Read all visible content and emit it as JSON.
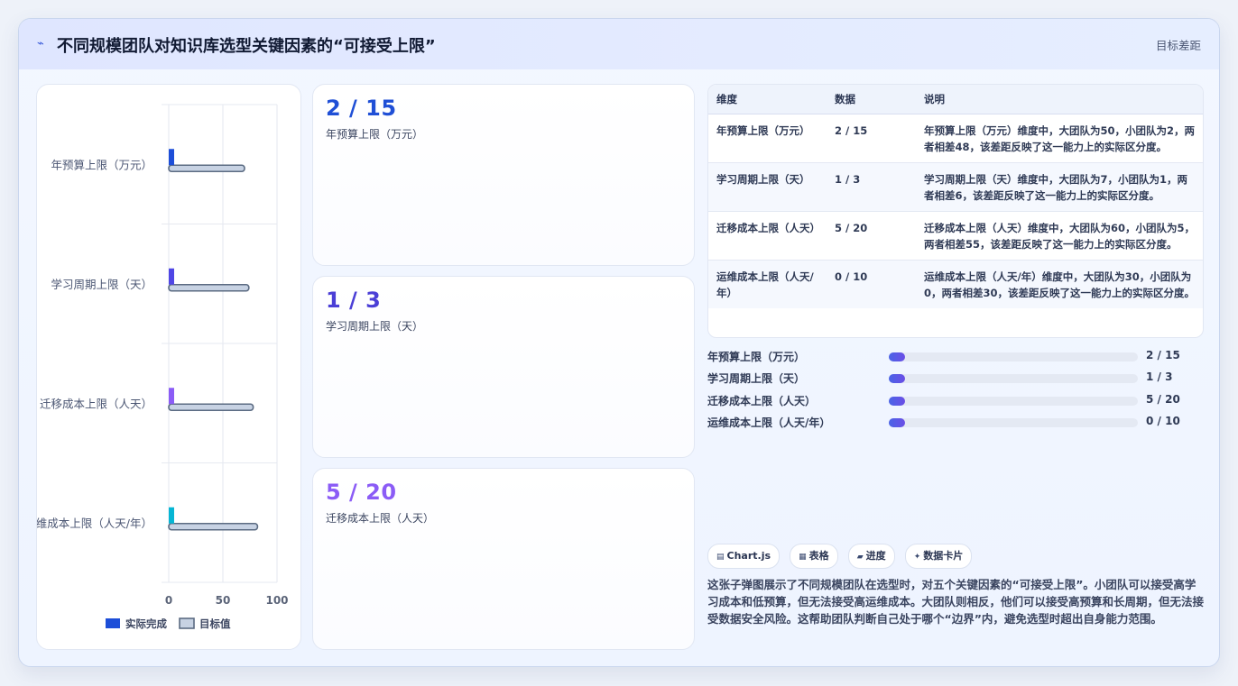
{
  "header": {
    "icon": "chart-pulse-icon",
    "title": "不同规模团队对知识库选型关键因素的“可接受上限”",
    "right_label": "目标差距"
  },
  "stats": [
    {
      "value": "2 / 15",
      "label": "年预算上限（万元）",
      "color": "#1f4fd6"
    },
    {
      "value": "1 / 3",
      "label": "学习周期上限（天）",
      "color": "#4b3fd6"
    },
    {
      "value": "5 / 20",
      "label": "迁移成本上限（人天）",
      "color": "#8b5cf6"
    }
  ],
  "table": {
    "headers": [
      "维度",
      "数据",
      "说明"
    ],
    "rows": [
      {
        "dim": "年预算上限（万元）",
        "data": "2 / 15",
        "desc": "年预算上限（万元）维度中，大团队为50，小团队为2，两者相差48，该差距反映了这一能力上的实际区分度。"
      },
      {
        "dim": "学习周期上限（天）",
        "data": "1 / 3",
        "desc": "学习周期上限（天）维度中，大团队为7，小团队为1，两者相差6，该差距反映了这一能力上的实际区分度。"
      },
      {
        "dim": "迁移成本上限（人天）",
        "data": "5 / 20",
        "desc": "迁移成本上限（人天）维度中，大团队为60，小团队为5，两者相差55，该差距反映了这一能力上的实际区分度。"
      },
      {
        "dim": "运维成本上限（人天/年）",
        "data": "0 / 10",
        "desc": "运维成本上限（人天/年）维度中，大团队为30，小团队为0，两者相差30，该差距反映了这一能力上的实际区分度。"
      }
    ]
  },
  "progress": [
    {
      "label": "年预算上限（万元）",
      "value": "2 / 15",
      "fraction": 0.067
    },
    {
      "label": "学习周期上限（天）",
      "value": "1 / 3",
      "fraction": 0.067
    },
    {
      "label": "迁移成本上限（人天）",
      "value": "5 / 20",
      "fraction": 0.067
    },
    {
      "label": "运维成本上限（人天/年）",
      "value": "0 / 10",
      "fraction": 0.067
    }
  ],
  "chips": [
    {
      "icon": "table-icon",
      "label": "Chart.js"
    },
    {
      "icon": "grid-icon",
      "label": "表格"
    },
    {
      "icon": "progress-icon",
      "label": "进度"
    },
    {
      "icon": "sparkle-icon",
      "label": "数据卡片"
    }
  ],
  "description": "这张子弹图展示了不同规模团队在选型时，对五个关键因素的“可接受上限”。小团队可以接受高学习成本和低预算，但无法接受高运维成本。大团队则相反，他们可以接受高预算和长周期，但无法接受数据安全风险。这帮助团队判断自己处于哪个“边界”内，避免选型时超出自身能力范围。",
  "chart_data": {
    "type": "bar",
    "orientation": "horizontal",
    "categories": [
      "年预算上限（万元）",
      "学习周期上限（天）",
      "迁移成本上限（人天）",
      "运维成本上限（人天/年）"
    ],
    "series": [
      {
        "name": "实际完成",
        "values": [
          5,
          5,
          5,
          5
        ],
        "colors": [
          "#1d4ed8",
          "#4f46e5",
          "#8b5cf6",
          "#06b6d4"
        ]
      },
      {
        "name": "目标值",
        "values": [
          70,
          74,
          78,
          82
        ],
        "color": "#c7d2e3",
        "border": "#5b6b82"
      }
    ],
    "xlim": [
      0,
      100
    ],
    "xticks": [
      0,
      50,
      100
    ],
    "grid": true,
    "legend": "bottom"
  }
}
